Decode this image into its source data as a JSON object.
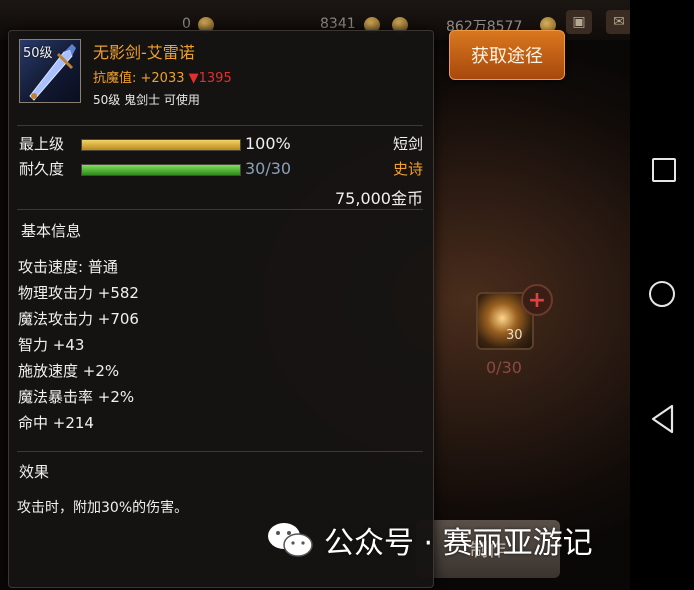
{
  "top_bar": {
    "val_1": "0",
    "val_2": "8341",
    "val_3": "862万8577"
  },
  "get_button": {
    "label": "获取途径"
  },
  "background": {
    "material_count": "30",
    "material_progress": "0/30",
    "bottom_button_label": "制作"
  },
  "tooltip": {
    "item_level_badge": "50级",
    "item_name": "无影剑-艾雷诺",
    "resist_label": "抗魔值: +2033",
    "resist_down": "▼1395",
    "class_line": "50级 鬼剑士 可使用",
    "grade": {
      "label": "最上级",
      "value": "100%",
      "percent": 100
    },
    "durability": {
      "label": "耐久度",
      "value": "30/30",
      "percent": 100
    },
    "weapon_type": "短剑",
    "rarity": "史诗",
    "price": "75,000金币",
    "basic_info_title": "基本信息",
    "attributes": [
      "攻击速度: 普通",
      "物理攻击力 +582",
      "魔法攻击力 +706",
      "智力 +43",
      "施放速度 +2%",
      "魔法暴击率 +2%",
      "命中 +214"
    ],
    "effect_title": "效果",
    "effect_text": "攻击时，附加30%的伤害。"
  },
  "watermark": {
    "text": "公众号 · 赛丽亚游记"
  },
  "colors": {
    "item_name": "#f0a030",
    "rarity_epic": "#f0a030",
    "down_arrow": "#e03030",
    "durability_text": "#8aa0b8",
    "button_orange": "#d9781e"
  },
  "icons": {
    "top_bar": [
      "coin-icon",
      "gem-icon",
      "gold-coin-icon",
      "chest-icon",
      "mail-icon",
      "chat-icon"
    ],
    "nav": [
      "recent-apps-icon",
      "home-icon",
      "back-icon"
    ],
    "item": "sword-icon",
    "watermark": "wechat-icon"
  }
}
